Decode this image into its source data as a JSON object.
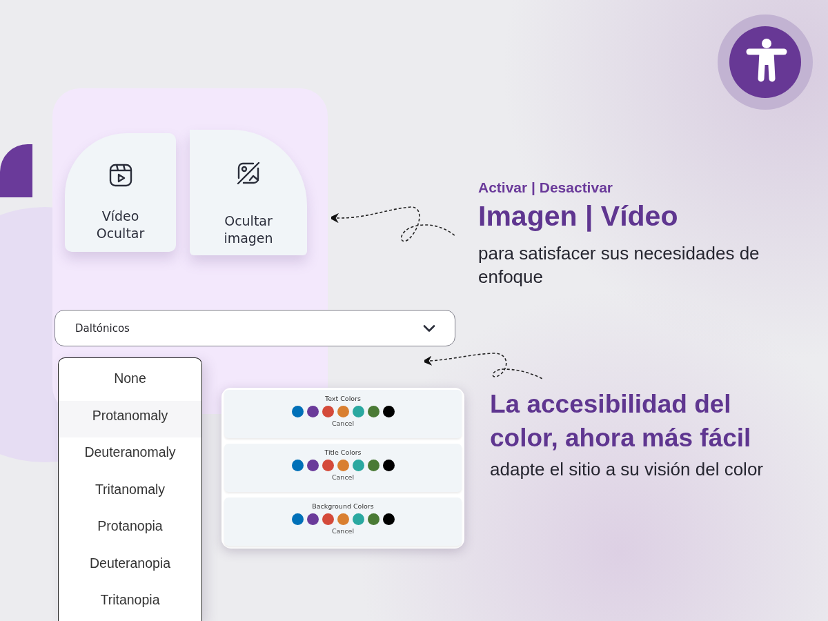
{
  "toggle_cards": [
    {
      "kind": "video",
      "label": "Vídeo Ocultar"
    },
    {
      "kind": "image",
      "label": "Ocultar imagen"
    }
  ],
  "dropdown": {
    "value": "Daltónicos",
    "expanded": true,
    "options": [
      "None",
      "Protanomaly",
      "Deuteranomaly",
      "Tritanomaly",
      "Protanopia",
      "Deuteranopia",
      "Tritanopia"
    ]
  },
  "color_pickers": [
    {
      "title": "Text Colors",
      "swatches": [
        {
          "color": "#0070b8"
        },
        {
          "color": "#6a3a9a"
        },
        {
          "color": "#d44a3a"
        },
        {
          "color": "#d97f30"
        },
        {
          "color": "#2aa8a0"
        },
        {
          "color": "#4a7a35"
        },
        {
          "color": "#000000"
        }
      ],
      "cancel": "Cancel"
    },
    {
      "title": "Title Colors",
      "swatches": [
        {
          "color": "#0070b8"
        },
        {
          "color": "#6a3a9a"
        },
        {
          "color": "#d44a3a"
        },
        {
          "color": "#d97f30"
        },
        {
          "color": "#2aa8a0"
        },
        {
          "color": "#4a7a35"
        },
        {
          "color": "#000000"
        }
      ],
      "cancel": "Cancel"
    },
    {
      "title": "Background Colors",
      "swatches": [
        {
          "color": "#0070b8"
        },
        {
          "color": "#6a3a9a"
        },
        {
          "color": "#d44a3a"
        },
        {
          "color": "#d97f30"
        },
        {
          "color": "#2aa8a0"
        },
        {
          "color": "#4a7a35"
        },
        {
          "color": "#000000"
        }
      ],
      "cancel": "Cancel"
    }
  ],
  "feature_1": {
    "eyebrow": "Activar | Desactivar",
    "title": "Imagen | Vídeo",
    "body": "para satisfacer sus necesidades de enfoque"
  },
  "feature_2": {
    "title": "La accesibilidad del color, ahora más fácil",
    "body": "adapte el sitio a su visión del color"
  }
}
